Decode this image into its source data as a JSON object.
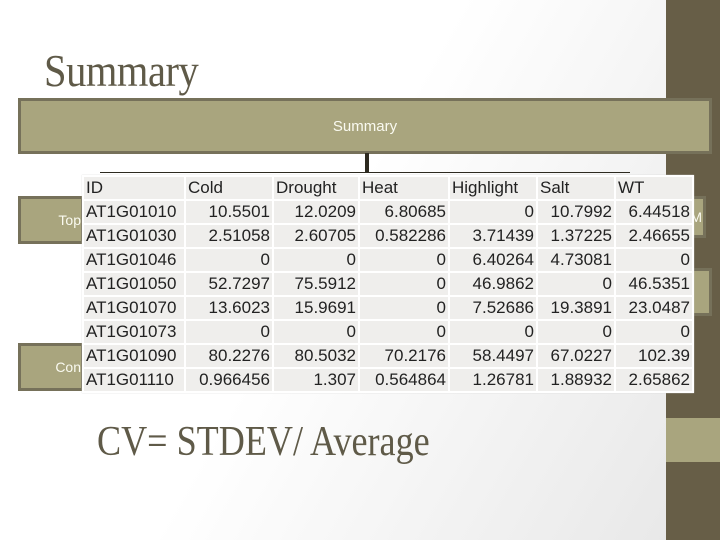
{
  "slide": {
    "title": "Summary",
    "summary_box_label": "Summary",
    "side_boxes": {
      "left_top": "Top",
      "left_bottom": "Con",
      "right_top": "KM",
      "right_bottom": ""
    },
    "formula": "CV= STDEV/ Average"
  },
  "table": {
    "headers": [
      "ID",
      "Cold",
      "Drought",
      "Heat",
      "Highlight",
      "Salt",
      "WT"
    ],
    "rows": [
      [
        "AT1G01010",
        "10.5501",
        "12.0209",
        "6.80685",
        "0",
        "10.7992",
        "6.44518"
      ],
      [
        "AT1G01030",
        "2.51058",
        "2.60705",
        "0.582286",
        "3.71439",
        "1.37225",
        "2.46655"
      ],
      [
        "AT1G01046",
        "0",
        "0",
        "0",
        "6.40264",
        "4.73081",
        "0"
      ],
      [
        "AT1G01050",
        "52.7297",
        "75.5912",
        "0",
        "46.9862",
        "0",
        "46.5351"
      ],
      [
        "AT1G01070",
        "13.6023",
        "15.9691",
        "0",
        "7.52686",
        "19.3891",
        "23.0487"
      ],
      [
        "AT1G01073",
        "0",
        "0",
        "0",
        "0",
        "0",
        "0"
      ],
      [
        "AT1G01090",
        "80.2276",
        "80.5032",
        "70.2176",
        "58.4497",
        "67.0227",
        "102.39"
      ],
      [
        "AT1G01110",
        "0.966456",
        "1.307",
        "0.564864",
        "1.26781",
        "1.88932",
        "2.65862"
      ]
    ]
  },
  "colors": {
    "accent_box": "#a9a57e",
    "accent_border": "#76715a",
    "dark_strip": "#675e47",
    "title_text": "#5f5a48"
  }
}
